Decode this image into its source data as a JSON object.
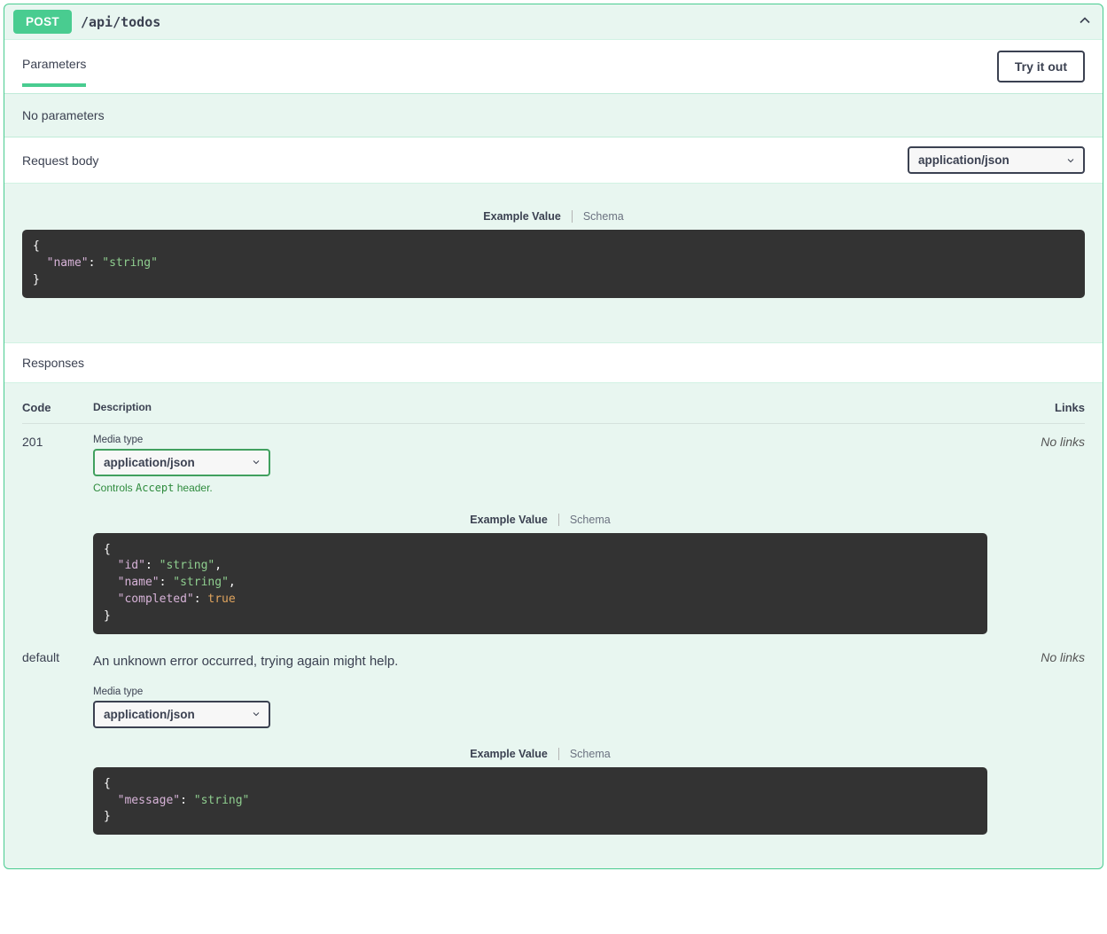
{
  "op": {
    "method": "POST",
    "path": "/api/todos"
  },
  "sections": {
    "parameters": "Parameters",
    "tryItOut": "Try it out",
    "noParams": "No parameters",
    "requestBody": "Request body",
    "responses": "Responses"
  },
  "contentTypeSelect": "application/json",
  "tabs": {
    "example": "Example Value",
    "schema": "Schema"
  },
  "requestExample": {
    "open": "{",
    "l1_key": "\"name\"",
    "l1_val": "\"string\"",
    "close": "}"
  },
  "tableHeaders": {
    "code": "Code",
    "description": "Description",
    "links": "Links"
  },
  "mediaTypeLabel": "Media type",
  "acceptNote": {
    "pre": "Controls ",
    "codeWord": "Accept",
    "post": " header."
  },
  "responses": {
    "r201": {
      "code": "201",
      "links": "No links",
      "mediaType": "application/json",
      "example": {
        "open": "{",
        "l1_key": "\"id\"",
        "l1_val": "\"string\"",
        "l2_key": "\"name\"",
        "l2_val": "\"string\"",
        "l3_key": "\"completed\"",
        "l3_val": "true",
        "close": "}"
      }
    },
    "rdefault": {
      "code": "default",
      "links": "No links",
      "description": "An unknown error occurred, trying again might help.",
      "mediaType": "application/json",
      "example": {
        "open": "{",
        "l1_key": "\"message\"",
        "l1_val": "\"string\"",
        "close": "}"
      }
    }
  }
}
